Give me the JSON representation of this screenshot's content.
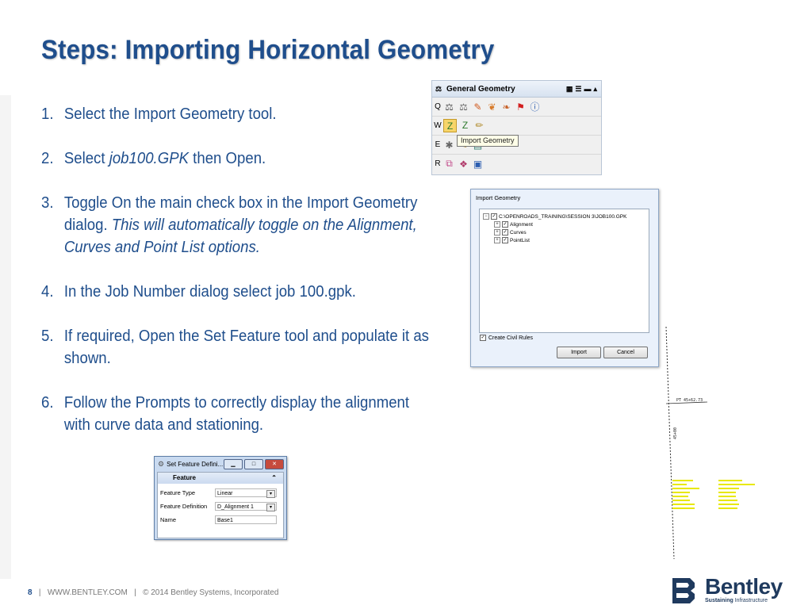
{
  "title": "Steps:  Importing Horizontal Geometry",
  "steps": [
    {
      "num": "1.",
      "text": "Select the Import Geometry tool."
    },
    {
      "num": "2.",
      "pre": "Select ",
      "italic": "job100.GPK",
      "post": " then Open."
    },
    {
      "num": "3.",
      "text": "Toggle On the main check box in the Import Geometry dialog. ",
      "italic": "This will automatically toggle on the Alignment, Curves and Point List options."
    },
    {
      "num": "4.",
      "text": "In the Job Number dialog select job 100.gpk."
    },
    {
      "num": "5.",
      "text": "If required, Open the Set Feature tool and populate it as shown."
    },
    {
      "num": "6.",
      "text": "Follow the Prompts to correctly display the alignment with curve data and stationing."
    }
  ],
  "toolbar": {
    "title": "General Geometry",
    "rows": [
      "Q",
      "W",
      "E",
      "R"
    ],
    "tooltip": "Import Geometry"
  },
  "import_dialog": {
    "title": "Import Geometry",
    "root": "C:\\OPENROADS_TRAINING\\SESSION 3\\JOB100.GPK",
    "items": [
      "Alignment",
      "Curves",
      "PointList"
    ],
    "create_civil_rules": "Create Civil Rules",
    "import_label": "Import",
    "cancel_label": "Cancel"
  },
  "set_feature": {
    "title": "Set Feature Defini...",
    "section": "Feature",
    "rows": [
      {
        "label": "Feature Type",
        "value": "Linear"
      },
      {
        "label": "Feature Definition",
        "value": "D_Alignment 1"
      },
      {
        "label": "Name",
        "value": "Base1"
      }
    ]
  },
  "cad": {
    "pt_label": "PT 45+62.73",
    "station_label": "45+00"
  },
  "footer": {
    "page": "8",
    "website": "WWW.BENTLEY.COM",
    "copyright": "©  2014 Bentley Systems, Incorporated"
  },
  "logo": {
    "name": "Bentley",
    "tagline_bold": "Sustaining",
    "tagline_rest": "Infrastructure"
  },
  "colors": {
    "title_blue": "#1f4e8c",
    "cad_yellow": "#e8e800"
  }
}
